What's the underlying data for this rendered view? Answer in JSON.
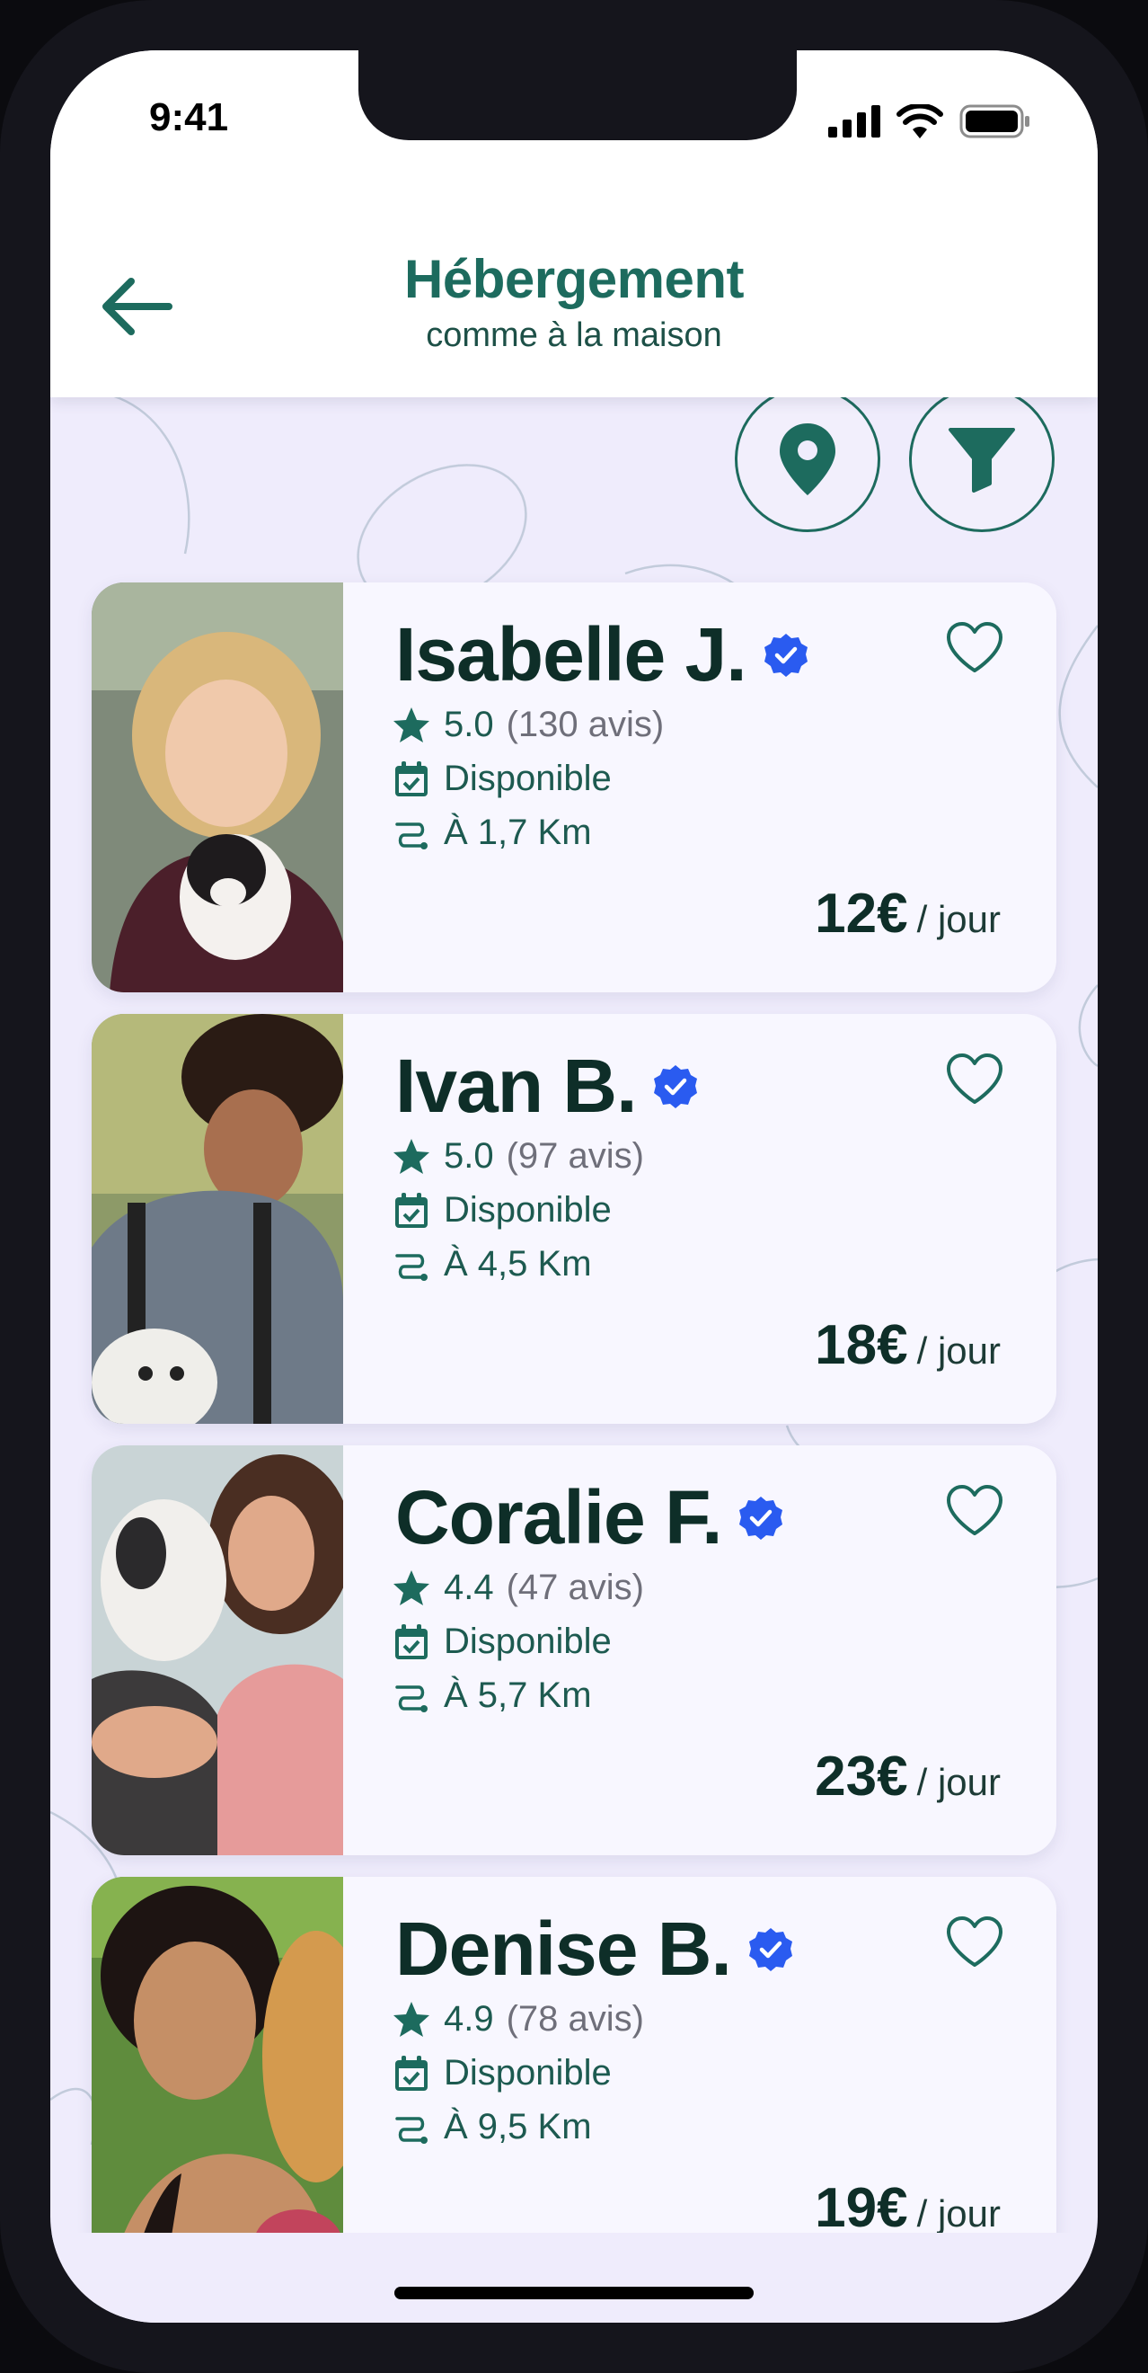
{
  "status_bar": {
    "time": "9:41"
  },
  "header": {
    "title": "Hébergement",
    "subtitle": "comme à la maison"
  },
  "colors": {
    "accent": "#1d6b5e",
    "dark_text": "#0e2e28",
    "verified_blue": "#2a5bf0",
    "background": "#efecfc",
    "card": "#f8f7ff"
  },
  "actions": {
    "location_icon": "map-pin-icon",
    "filter_icon": "filter-icon"
  },
  "sitters": [
    {
      "name": "Isabelle J.",
      "verified": true,
      "rating": "5.0",
      "reviews": "(130 avis)",
      "availability": "Disponible",
      "distance": "À 1,7 Km",
      "price": "12€",
      "unit": "/ jour"
    },
    {
      "name": "Ivan B.",
      "verified": true,
      "rating": "5.0",
      "reviews": "(97 avis)",
      "availability": "Disponible",
      "distance": "À 4,5 Km",
      "price": "18€",
      "unit": "/ jour"
    },
    {
      "name": "Coralie F.",
      "verified": true,
      "rating": "4.4",
      "reviews": "(47 avis)",
      "availability": "Disponible",
      "distance": "À 5,7 Km",
      "price": "23€",
      "unit": "/ jour"
    },
    {
      "name": "Denise B.",
      "verified": true,
      "rating": "4.9",
      "reviews": "(78 avis)",
      "availability": "Disponible",
      "distance": "À 9,5 Km",
      "price": "19€",
      "unit": "/ jour"
    }
  ]
}
